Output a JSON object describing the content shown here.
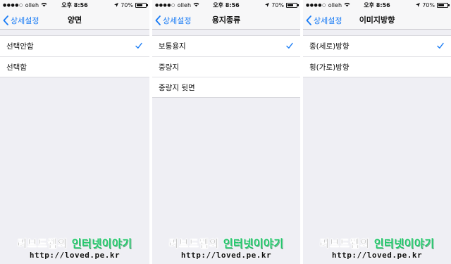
{
  "status": {
    "carrier": "olleh",
    "time": "오후 8:56",
    "battery": "70%",
    "battery_level": 0.7
  },
  "screens": [
    {
      "back_label": "상세설정",
      "title": "양면",
      "options": [
        {
          "label": "선택안함",
          "selected": true
        },
        {
          "label": "선택함",
          "selected": false
        }
      ]
    },
    {
      "back_label": "상세설정",
      "title": "용지종류",
      "options": [
        {
          "label": "보통용지",
          "selected": true
        },
        {
          "label": "중량지",
          "selected": false
        },
        {
          "label": "중량지 뒷면",
          "selected": false
        }
      ]
    },
    {
      "back_label": "상세설정",
      "title": "이미지방향",
      "options": [
        {
          "label": "종(세로)방향",
          "selected": true
        },
        {
          "label": "횡(가로)방향",
          "selected": false
        }
      ]
    }
  ],
  "watermark": {
    "part1": "러브드웹의",
    "part2": "인터넷이야기",
    "url": "http://loved.pe.kr"
  },
  "colors": {
    "accent": "#1a7cf5",
    "watermark_green": "#1fc76a",
    "background": "#efeff4"
  }
}
